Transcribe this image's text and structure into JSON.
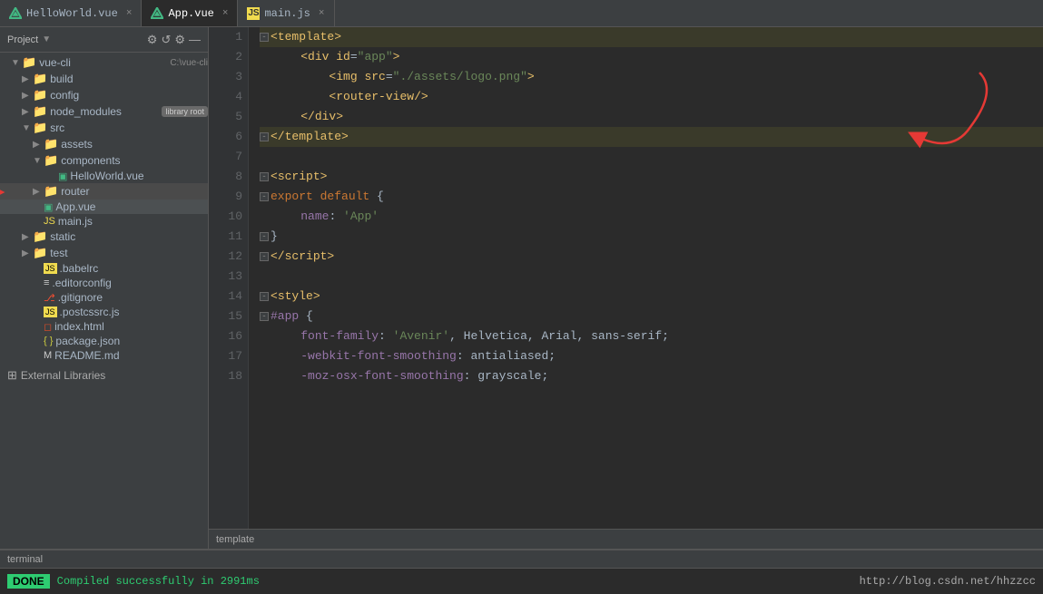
{
  "header": {
    "tabs": [
      {
        "id": "helloworld",
        "label": "HelloWorld.vue",
        "type": "vue",
        "active": false
      },
      {
        "id": "app",
        "label": "App.vue",
        "type": "vue",
        "active": true
      },
      {
        "id": "main",
        "label": "main.js",
        "type": "js",
        "active": false
      }
    ]
  },
  "sidebar": {
    "title": "Project",
    "root": "vue-cli",
    "rootPath": "C:\\vue-cli",
    "tree": [
      {
        "level": 1,
        "type": "folder",
        "open": true,
        "label": "vue-cli"
      },
      {
        "level": 2,
        "type": "folder",
        "open": false,
        "label": "build"
      },
      {
        "level": 2,
        "type": "folder",
        "open": false,
        "label": "config"
      },
      {
        "level": 2,
        "type": "folder",
        "open": false,
        "label": "node_modules",
        "badge": "library root"
      },
      {
        "level": 2,
        "type": "folder",
        "open": true,
        "label": "src"
      },
      {
        "level": 3,
        "type": "folder",
        "open": false,
        "label": "assets"
      },
      {
        "level": 3,
        "type": "folder",
        "open": true,
        "label": "components"
      },
      {
        "level": 4,
        "type": "file",
        "fileType": "vue",
        "label": "HelloWorld.vue"
      },
      {
        "level": 3,
        "type": "folder",
        "open": false,
        "label": "router",
        "highlighted": true
      },
      {
        "level": 3,
        "type": "file",
        "fileType": "vue",
        "label": "App.vue",
        "selected": true
      },
      {
        "level": 3,
        "type": "file",
        "fileType": "js",
        "label": "main.js"
      },
      {
        "level": 2,
        "type": "folder",
        "open": false,
        "label": "static"
      },
      {
        "level": 2,
        "type": "folder",
        "open": false,
        "label": "test"
      },
      {
        "level": 2,
        "type": "file",
        "fileType": "rc",
        "label": ".babelrc"
      },
      {
        "level": 2,
        "type": "file",
        "fileType": "rc",
        "label": ".editorconfig"
      },
      {
        "level": 2,
        "type": "file",
        "fileType": "git",
        "label": ".gitignore"
      },
      {
        "level": 2,
        "type": "file",
        "fileType": "css",
        "label": ".postcssrc.js"
      },
      {
        "level": 2,
        "type": "file",
        "fileType": "html",
        "label": "index.html"
      },
      {
        "level": 2,
        "type": "file",
        "fileType": "json",
        "label": "package.json"
      },
      {
        "level": 2,
        "type": "file",
        "fileType": "md",
        "label": "README.md"
      }
    ],
    "externalLibs": "External Libraries"
  },
  "editor": {
    "lines": [
      {
        "num": 1,
        "highlighted": true,
        "content": [
          {
            "type": "tag-bracket",
            "text": "<"
          },
          {
            "type": "tag",
            "text": "template"
          },
          {
            "type": "tag-bracket",
            "text": ">"
          }
        ]
      },
      {
        "num": 2,
        "content": [
          {
            "type": "plain",
            "text": "    "
          },
          {
            "type": "tag-bracket",
            "text": "<"
          },
          {
            "type": "tag",
            "text": "div id"
          },
          {
            "type": "plain",
            "text": "="
          },
          {
            "type": "attr-value",
            "text": "\"app\""
          },
          {
            "type": "tag-bracket",
            "text": ">"
          }
        ]
      },
      {
        "num": 3,
        "content": [
          {
            "type": "plain",
            "text": "        "
          },
          {
            "type": "tag-bracket",
            "text": "<"
          },
          {
            "type": "tag",
            "text": "img src"
          },
          {
            "type": "plain",
            "text": "="
          },
          {
            "type": "attr-value",
            "text": "\"./assets/logo.png\""
          },
          {
            "type": "tag-bracket",
            "text": ">"
          }
        ]
      },
      {
        "num": 4,
        "content": [
          {
            "type": "plain",
            "text": "        "
          },
          {
            "type": "tag-bracket",
            "text": "<"
          },
          {
            "type": "tag",
            "text": "router-view"
          },
          {
            "type": "tag-bracket",
            "text": "/>"
          }
        ]
      },
      {
        "num": 5,
        "content": [
          {
            "type": "plain",
            "text": "    "
          },
          {
            "type": "tag-bracket",
            "text": "</"
          },
          {
            "type": "tag",
            "text": "div"
          },
          {
            "type": "tag-bracket",
            "text": ">"
          }
        ]
      },
      {
        "num": 6,
        "highlighted": true,
        "content": [
          {
            "type": "tag-bracket",
            "text": "</"
          },
          {
            "type": "tag",
            "text": "template"
          },
          {
            "type": "tag-bracket",
            "text": ">"
          }
        ]
      },
      {
        "num": 7,
        "content": []
      },
      {
        "num": 8,
        "content": [
          {
            "type": "tag-bracket",
            "text": "<"
          },
          {
            "type": "tag",
            "text": "script"
          },
          {
            "type": "tag-bracket",
            "text": ">"
          }
        ]
      },
      {
        "num": 9,
        "content": [
          {
            "type": "keyword",
            "text": "export default"
          },
          {
            "type": "plain",
            "text": " {"
          }
        ]
      },
      {
        "num": 10,
        "content": [
          {
            "type": "plain",
            "text": "    "
          },
          {
            "type": "property",
            "text": "name"
          },
          {
            "type": "plain",
            "text": ": "
          },
          {
            "type": "string",
            "text": "'App'"
          }
        ]
      },
      {
        "num": 11,
        "content": [
          {
            "type": "plain",
            "text": "}"
          }
        ]
      },
      {
        "num": 12,
        "content": [
          {
            "type": "tag-bracket",
            "text": "</"
          },
          {
            "type": "tag",
            "text": "script"
          },
          {
            "type": "tag-bracket",
            "text": ">"
          }
        ]
      },
      {
        "num": 13,
        "content": []
      },
      {
        "num": 14,
        "content": [
          {
            "type": "tag-bracket",
            "text": "<"
          },
          {
            "type": "tag",
            "text": "style"
          },
          {
            "type": "tag-bracket",
            "text": ">"
          }
        ]
      },
      {
        "num": 15,
        "content": [
          {
            "type": "property",
            "text": "#app"
          },
          {
            "type": "plain",
            "text": " {"
          }
        ]
      },
      {
        "num": 16,
        "content": [
          {
            "type": "plain",
            "text": "    "
          },
          {
            "type": "property",
            "text": "font-family"
          },
          {
            "type": "plain",
            "text": ": "
          },
          {
            "type": "string",
            "text": "'Avenir'"
          },
          {
            "type": "plain",
            "text": ", Helvetica, Arial, sans-serif;"
          }
        ]
      },
      {
        "num": 17,
        "content": [
          {
            "type": "plain",
            "text": "    "
          },
          {
            "type": "keyword",
            "text": "-webkit-font-smoothing"
          },
          {
            "type": "plain",
            "text": ": antialiased;"
          }
        ]
      },
      {
        "num": 18,
        "content": [
          {
            "type": "plain",
            "text": "    "
          },
          {
            "type": "keyword",
            "text": "-moz-osx-font-smoothing"
          },
          {
            "type": "plain",
            "text": ": grayscale;"
          }
        ]
      }
    ],
    "bottomLabel": "template"
  },
  "terminal": {
    "title": "terminal",
    "badge": "DONE",
    "message": "Compiled successfully in 2991ms",
    "url": "http://blog.csdn.net/hhzzcc"
  }
}
